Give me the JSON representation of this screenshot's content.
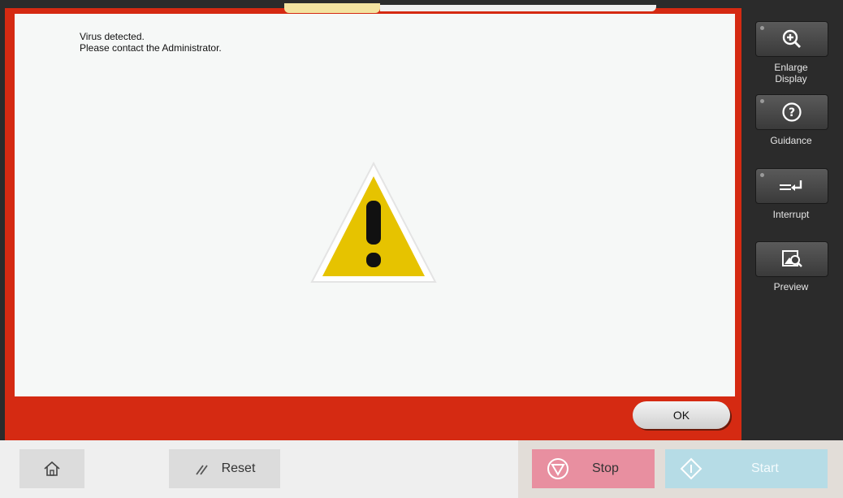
{
  "message": {
    "line1": "Virus detected.",
    "line2": "Please contact the Administrator."
  },
  "dialog": {
    "ok_label": "OK",
    "icon": "warning-triangle-icon",
    "frame_color": "#d52a12"
  },
  "side_panel": {
    "enlarge_line1": "Enlarge",
    "enlarge_line2": "Display",
    "guidance": "Guidance",
    "interrupt": "Interrupt",
    "preview": "Preview"
  },
  "bottom_bar": {
    "reset_label": "Reset",
    "stop_label": "Stop",
    "start_label": "Start",
    "stop_color": "#e88fa0",
    "start_color": "#b6dce6"
  }
}
